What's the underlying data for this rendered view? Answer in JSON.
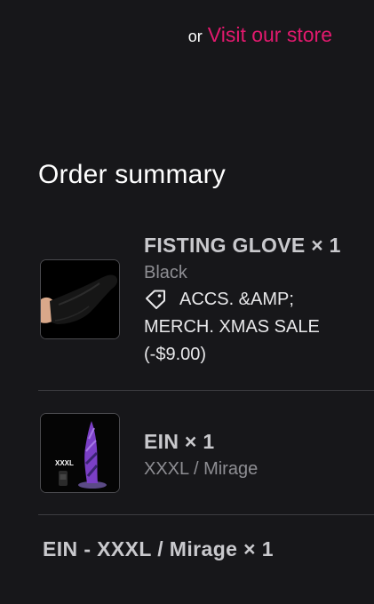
{
  "store": {
    "prefix": "or",
    "link_label": "Visit our store"
  },
  "summary": {
    "title": "Order summary"
  },
  "items": [
    {
      "name": "FISTING GLOVE × 1",
      "variant": "Black",
      "discount_icon": "tag-icon",
      "discount": "ACCS. &AMP; MERCH. XMAS SALE (-$9.00)"
    },
    {
      "name": "EIN × 1",
      "variant": "XXXL / Mirage",
      "image_label": "XXXL"
    }
  ],
  "extra_line": "EIN - XXXL / Mirage × 1",
  "colors": {
    "background": "#17171a",
    "link": "#e2196e",
    "muted": "#8e8e93",
    "divider": "#3d3d41"
  }
}
